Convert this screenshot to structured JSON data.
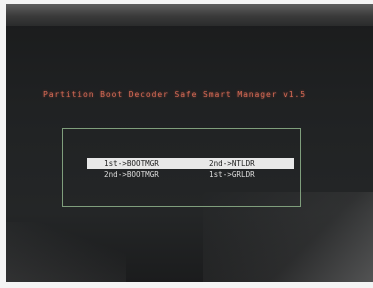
{
  "title": "Partition Boot Decoder Safe Smart Manager v1.5",
  "menu": {
    "rows": [
      {
        "left": "1st->BOOTMGR",
        "right": "2nd->NTLDR",
        "selected": true
      },
      {
        "left": "2nd->BOOTMGR",
        "right": "1st->GRLDR",
        "selected": false
      }
    ]
  },
  "colors": {
    "title": "#d36a55",
    "box_border": "#7f9e7c",
    "highlight_bg": "#e8e8e8",
    "highlight_text": "#1e1e1e",
    "normal_text": "#dcdcdc",
    "screen_bg": "#202223"
  }
}
